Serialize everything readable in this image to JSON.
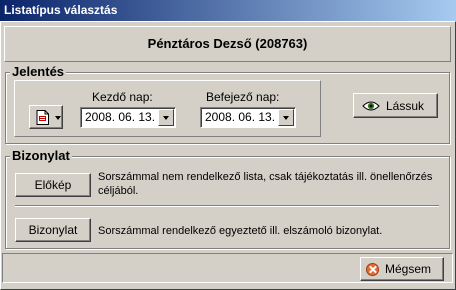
{
  "window": {
    "title": "Listatípus választás"
  },
  "header": {
    "name": "Pénztáros Dezső (208763)"
  },
  "report": {
    "legend": "Jelentés",
    "start_label": "Kezdő nap:",
    "start_value": "2008. 06. 13.",
    "end_label": "Befejező nap:",
    "end_value": "2008. 06. 13.",
    "view_button": "Lássuk",
    "format_icon": "document-format-icon"
  },
  "receipt": {
    "legend": "Bizonylat",
    "preview_button": "Előkép",
    "preview_desc": "Sorszámmal nem rendelkező lista, csak tájékoztatás ill. önellenőrzés céljából.",
    "receipt_button": "Bizonylat",
    "receipt_desc": "Sorszámmal rendelkező egyeztető ill. elszámoló bizonylat."
  },
  "footer": {
    "cancel_button": "Mégsem"
  },
  "colors": {
    "face": "#d4d0c8",
    "title_start": "#0a246a",
    "title_end": "#a6caf0"
  }
}
